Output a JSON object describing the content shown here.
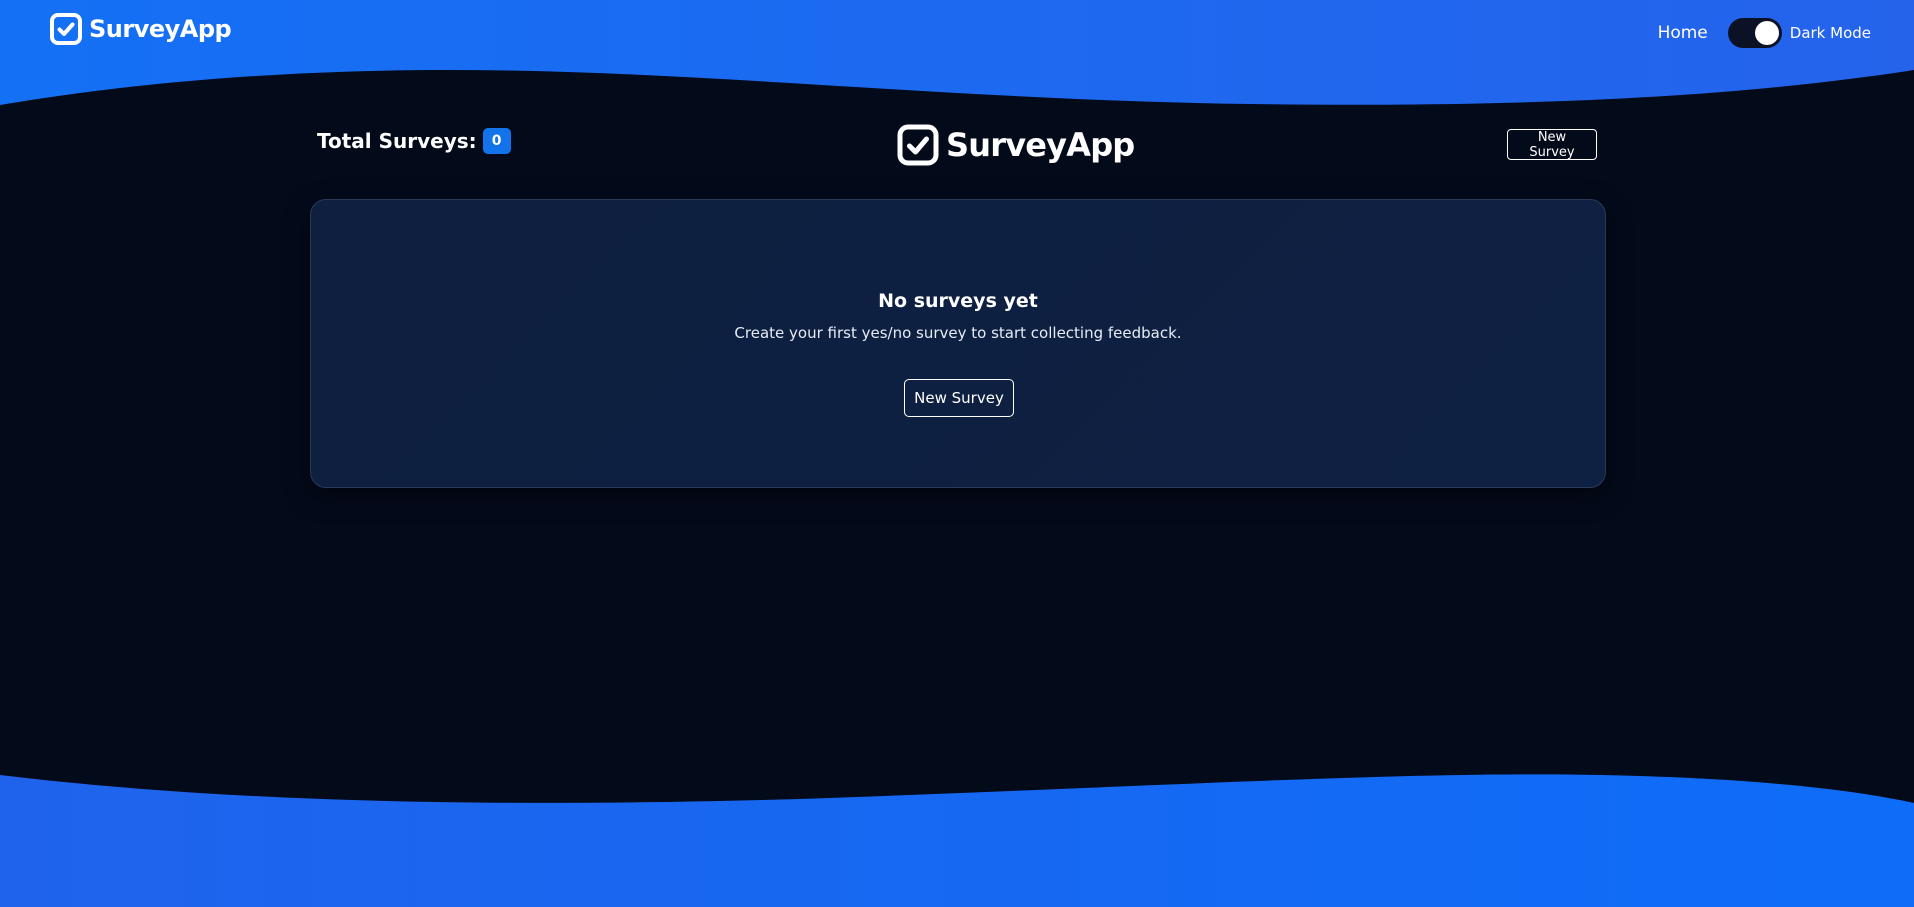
{
  "navbar": {
    "brand": "SurveyApp",
    "home_link": "Home",
    "dark_mode_label": "Dark Mode"
  },
  "header": {
    "total_label": "Total Surveys:",
    "total_count": "0",
    "logo_text": "SurveyApp",
    "new_survey_label": "New Survey"
  },
  "empty_state": {
    "title": "No surveys yet",
    "subtitle": "Create your first yes/no survey to start collecting feedback.",
    "button_label": "New Survey"
  },
  "theme": {
    "accent": "#1273ea",
    "background": "#030a1a",
    "card": "#0f2142",
    "dark_mode_on": true
  }
}
